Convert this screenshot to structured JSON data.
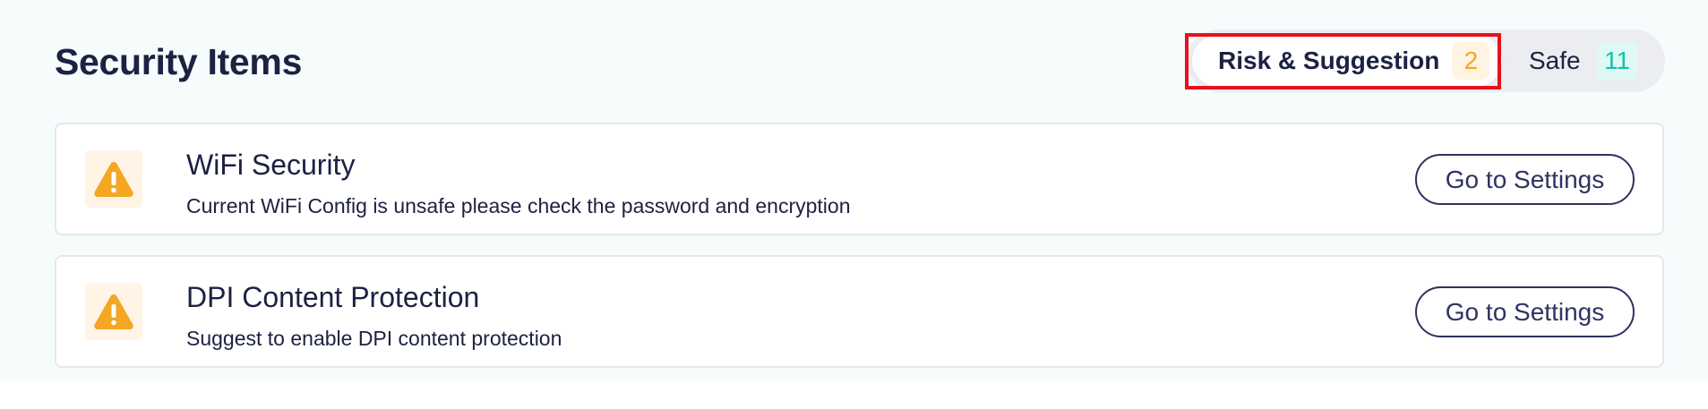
{
  "header": {
    "title": "Security Items"
  },
  "tabs": [
    {
      "label": "Risk & Suggestion",
      "count": "2",
      "selected": true,
      "badge_color": "#f5a623"
    },
    {
      "label": "Safe",
      "count": "11",
      "selected": false,
      "badge_color": "#13c2a8"
    }
  ],
  "items": [
    {
      "icon": "warning-icon",
      "title": "WiFi Security",
      "description": "Current WiFi Config is unsafe please check the password and encryption",
      "action_label": "Go to Settings"
    },
    {
      "icon": "warning-icon",
      "title": "DPI Content Protection",
      "description": "Suggest to enable DPI content protection",
      "action_label": "Go to Settings"
    }
  ],
  "colors": {
    "warning": "#f5a623",
    "highlight": "#e8101d",
    "text": "#1d2142"
  }
}
